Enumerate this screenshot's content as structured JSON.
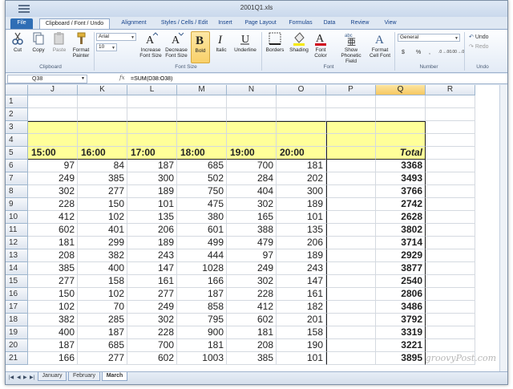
{
  "window": {
    "title": "2001Q1.xls"
  },
  "tabs": [
    "File",
    "Clipboard / Font / Undo",
    "Alignment",
    "Styles / Cells / Edit",
    "Insert",
    "Page Layout",
    "Formulas",
    "Data",
    "Review",
    "View"
  ],
  "ribbon": {
    "clipboard": {
      "cut": "Cut",
      "copy": "Copy",
      "paste": "Paste",
      "format_painter": "Format Painter",
      "group_label": "Clipboard"
    },
    "font": {
      "font_name": "Arial",
      "font_size": "10",
      "increase": "Increase Font Size",
      "decrease": "Decrease Font Size",
      "bold": "Bold",
      "italic": "Italic",
      "underline": "Underline",
      "size_group_label": "Font Size",
      "borders": "Borders",
      "shading": "Shading",
      "font_color": "Font Color",
      "phonetic": "Show Phonetic Field",
      "format_cell_font": "Format Cell Font",
      "group_label": "Font"
    },
    "number": {
      "format": "General",
      "currency": "$",
      "percent": "%",
      "comma": ",",
      "group_label": "Number"
    },
    "undo": {
      "undo": "Undo",
      "redo": "Redo",
      "group_label": "Undo"
    }
  },
  "formula_bar": {
    "name_box": "Q38",
    "fx": "fx",
    "formula": "=SUM(D38:O38)"
  },
  "grid": {
    "columns": [
      "J",
      "K",
      "L",
      "M",
      "N",
      "O",
      "P",
      "Q",
      "R"
    ],
    "selected_column": "Q",
    "header_row": [
      "15:00",
      "16:00",
      "17:00",
      "18:00",
      "19:00",
      "20:00",
      "",
      "Total"
    ],
    "rows": [
      {
        "row": "1",
        "values": []
      },
      {
        "row": "2",
        "values": []
      },
      {
        "row": "3",
        "values": []
      },
      {
        "row": "4",
        "values": []
      },
      {
        "row": "5",
        "values": []
      },
      {
        "row": "6",
        "values": [
          "97",
          "84",
          "187",
          "685",
          "700",
          "181",
          "",
          "3368"
        ]
      },
      {
        "row": "7",
        "values": [
          "249",
          "385",
          "300",
          "502",
          "284",
          "202",
          "",
          "3493"
        ]
      },
      {
        "row": "8",
        "values": [
          "302",
          "277",
          "189",
          "750",
          "404",
          "300",
          "",
          "3766"
        ]
      },
      {
        "row": "9",
        "values": [
          "228",
          "150",
          "101",
          "475",
          "302",
          "189",
          "",
          "2742"
        ]
      },
      {
        "row": "10",
        "values": [
          "412",
          "102",
          "135",
          "380",
          "165",
          "101",
          "",
          "2628"
        ]
      },
      {
        "row": "11",
        "values": [
          "602",
          "401",
          "206",
          "601",
          "388",
          "135",
          "",
          "3802"
        ]
      },
      {
        "row": "12",
        "values": [
          "181",
          "299",
          "189",
          "499",
          "479",
          "206",
          "",
          "3714"
        ]
      },
      {
        "row": "13",
        "values": [
          "208",
          "382",
          "243",
          "444",
          "97",
          "189",
          "",
          "2929"
        ]
      },
      {
        "row": "14",
        "values": [
          "385",
          "400",
          "147",
          "1028",
          "249",
          "243",
          "",
          "3877"
        ]
      },
      {
        "row": "15",
        "values": [
          "277",
          "158",
          "161",
          "166",
          "302",
          "147",
          "",
          "2540"
        ]
      },
      {
        "row": "16",
        "values": [
          "150",
          "102",
          "277",
          "187",
          "228",
          "161",
          "",
          "2806"
        ]
      },
      {
        "row": "17",
        "values": [
          "102",
          "70",
          "249",
          "858",
          "412",
          "182",
          "",
          "3486"
        ]
      },
      {
        "row": "18",
        "values": [
          "382",
          "285",
          "302",
          "795",
          "602",
          "201",
          "",
          "3792"
        ]
      },
      {
        "row": "19",
        "values": [
          "400",
          "187",
          "228",
          "900",
          "181",
          "158",
          "",
          "3319"
        ]
      },
      {
        "row": "20",
        "values": [
          "187",
          "685",
          "700",
          "181",
          "208",
          "190",
          "",
          "3221"
        ]
      },
      {
        "row": "21",
        "values": [
          "166",
          "277",
          "602",
          "1003",
          "385",
          "101",
          "",
          "3895"
        ]
      }
    ]
  },
  "sheets": [
    "January",
    "February",
    "March"
  ],
  "active_sheet": "March",
  "watermark": "groovyPost.com",
  "colors": {
    "highlight": "#ffff99",
    "file_tab": "#2f6eb5",
    "selected_header": "#f7c761"
  }
}
